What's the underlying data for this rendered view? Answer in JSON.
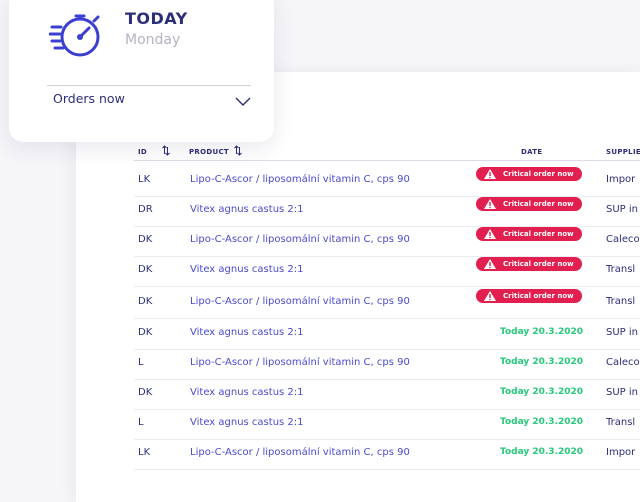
{
  "card": {
    "icon": "stopwatch-icon",
    "title": "TODAY",
    "weekday": "Monday",
    "orders_label": "Orders now"
  },
  "table": {
    "columns": {
      "id": "ID",
      "product": "PRODUCT",
      "date": "DATE",
      "supplier": "SUPPLIE"
    },
    "rows": [
      {
        "id": "LK",
        "product": "Lipo-C-Ascor / liposomální vitamin C, cps 90",
        "status": "critical",
        "date": "Critical order now",
        "supplier": "Impor"
      },
      {
        "id": "DR",
        "product": "Vitex agnus castus 2:1",
        "status": "critical",
        "date": "Critical order now",
        "supplier": "SUP in"
      },
      {
        "id": "DK",
        "product": "Lipo-C-Ascor / liposomální vitamin C, cps 90",
        "status": "critical",
        "date": "Critical order now",
        "supplier": "Caleco"
      },
      {
        "id": "DK",
        "product": "Vitex agnus castus 2:1",
        "status": "critical",
        "date": "Critical order now",
        "supplier": "Transl"
      },
      {
        "id": "DK",
        "product": "Lipo-C-Ascor / liposomální vitamin C, cps 90",
        "status": "critical",
        "date": "Critical order now",
        "supplier": "Transl"
      },
      {
        "id": "DK",
        "product": "Vitex agnus castus 2:1",
        "status": "today",
        "date": "Today 20.3.2020",
        "supplier": "SUP in"
      },
      {
        "id": "L",
        "product": "Lipo-C-Ascor / liposomální vitamin C, cps 90",
        "status": "today",
        "date": "Today 20.3.2020",
        "supplier": "Caleco"
      },
      {
        "id": "DK",
        "product": "Vitex agnus castus 2:1",
        "status": "today",
        "date": "Today 20.3.2020",
        "supplier": "SUP in"
      },
      {
        "id": "L",
        "product": "Vitex agnus castus 2:1",
        "status": "today",
        "date": "Today 20.3.2020",
        "supplier": "Transl"
      },
      {
        "id": "LK",
        "product": "Lipo-C-Ascor / liposomální vitamin C, cps 90",
        "status": "today",
        "date": "Today 20.3.2020",
        "supplier": "Impor"
      }
    ]
  },
  "colors": {
    "navy": "#2c2e7a",
    "product_link": "#4a4bd1",
    "critical": "#e1204f",
    "today_green": "#26c97a",
    "icon_blue": "#3b3fd1"
  }
}
